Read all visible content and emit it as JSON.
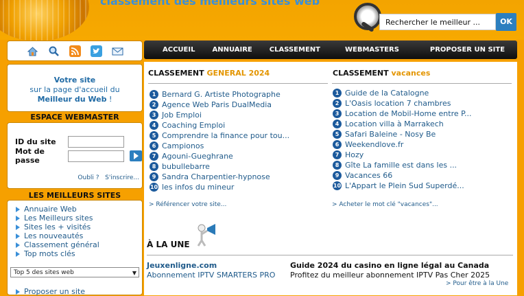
{
  "header": {
    "tagline": "classement des meilleurs sites web",
    "search_placeholder": "Rechercher le meilleur ...",
    "search_button": "OK"
  },
  "toolbar_icons": [
    "home-icon",
    "search-icon",
    "rss-icon",
    "twitter-icon",
    "mail-icon"
  ],
  "promo": {
    "line1": "Votre site",
    "line2": "sur la page d'accueil du",
    "line3": "Meilleur du Web",
    "line3_suffix": " !"
  },
  "webmaster": {
    "title": "ESPACE WEBMASTER",
    "id_label": "ID du site",
    "pass_label": "Mot de passe",
    "forgot": "Oubli ?",
    "signup": "S'inscrire..."
  },
  "best": {
    "title": "LES MEILLEURS SITES",
    "items": [
      "Annuaire Web",
      "Les Meilleurs sites",
      "Sites les + visités",
      "Les nouveautés",
      "Classement général",
      "Top mots clés"
    ],
    "select_value": "Top 5 des sites web",
    "propose": "Proposer un site"
  },
  "nav": [
    "ACCUEIL",
    "ANNUAIRE",
    "CLASSEMENT",
    "WEBMASTERS",
    "PROPOSER UN SITE"
  ],
  "ranking_general": {
    "title_main": "CLASSEMENT",
    "title_accent": "GENERAL 2024",
    "items": [
      "Bernard G. Artiste Photographe",
      "Agence Web Paris DualMedia",
      "Job Emploi",
      "Coaching Emploi",
      "Comprendre la finance pour tou...",
      "Campionos",
      "Agouni-Gueghrane",
      "bubullebarre",
      "Sandra Charpentier-hypnose",
      "les infos du mineur"
    ],
    "footer": "> Référencer votre site..."
  },
  "ranking_vacances": {
    "title_main": "CLASSEMENT",
    "title_accent": "vacances",
    "items": [
      "Guide de la Catalogne",
      "L'Oasis location 7 chambres",
      "Location de Mobil-Home entre P...",
      "Location villa à Marrakech",
      "Safari Baleine - Nosy Be",
      "Weekendlove.fr",
      "Hozy",
      "Gîte La famille est dans les ...",
      "Vacances 66",
      "L'Appart le Plein Sud Superdé..."
    ],
    "footer": "> Acheter le mot clé \"vacances\"..."
  },
  "une": {
    "title": "À LA UNE",
    "left_title": "Jeuxenligne.com",
    "left_sub": "Abonnement IPTV SMARTERS PRO",
    "right_title": "Guide 2024 du casino en ligne légal au Canada",
    "right_sub": "Profitez du meilleur abonnement IPTV Pas Cher 2025",
    "right_link": "> Pour être à la Une"
  }
}
